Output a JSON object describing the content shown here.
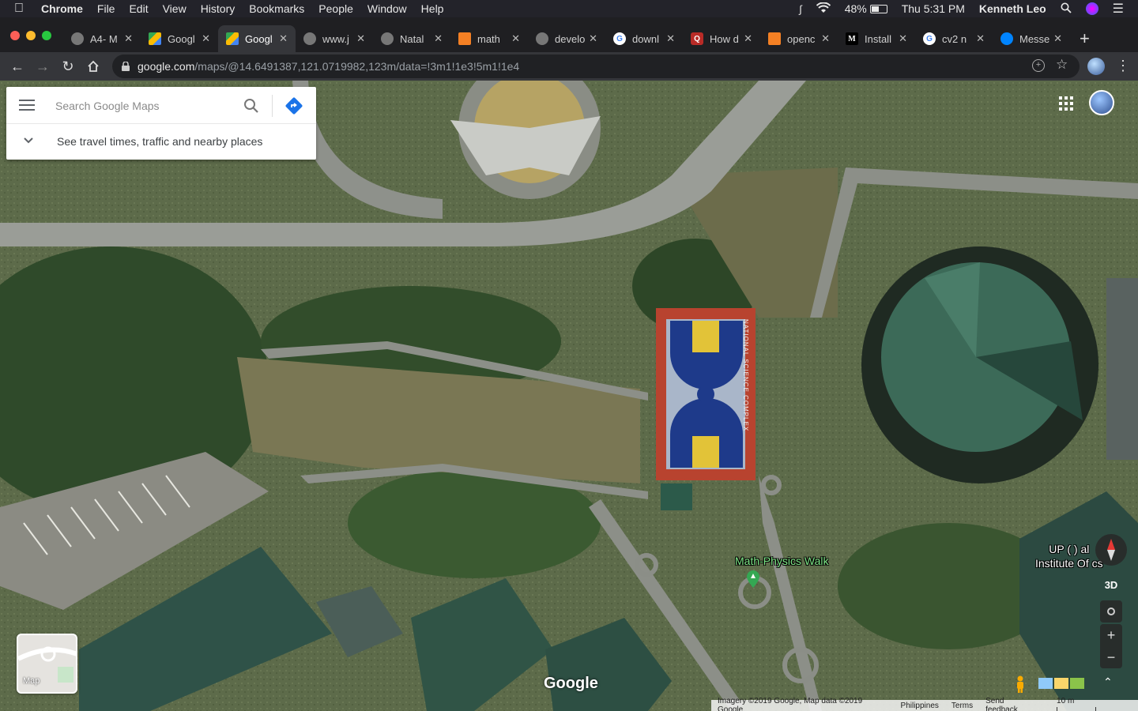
{
  "menubar": {
    "app": "Chrome",
    "items": [
      "File",
      "Edit",
      "View",
      "History",
      "Bookmarks",
      "People",
      "Window",
      "Help"
    ],
    "battery": "48%",
    "clock": "Thu 5:31 PM",
    "user": "Kenneth Leo"
  },
  "tabs": [
    {
      "label": "A4- M",
      "icon": "globe-icon"
    },
    {
      "label": "Googl",
      "icon": "maps-icon"
    },
    {
      "label": "Googl",
      "icon": "maps-icon",
      "active": true
    },
    {
      "label": "www.j",
      "icon": "globe-icon"
    },
    {
      "label": "Natal",
      "icon": "globe-icon"
    },
    {
      "label": "math",
      "icon": "stackoverflow-icon"
    },
    {
      "label": "develo",
      "icon": "globe-icon"
    },
    {
      "label": "downl",
      "icon": "google-icon"
    },
    {
      "label": "How d",
      "icon": "quora-icon"
    },
    {
      "label": "openc",
      "icon": "stackoverflow-icon"
    },
    {
      "label": "Install",
      "icon": "medium-icon"
    },
    {
      "label": "cv2 n",
      "icon": "google-icon"
    },
    {
      "label": "Messe",
      "icon": "messenger-icon"
    }
  ],
  "address": {
    "host": "google.com",
    "path": "/maps/@14.6491387,121.0719982,123m/data=!3m1!1e3!5m1!1e4"
  },
  "search": {
    "placeholder": "Search Google Maps",
    "travel_text": "See travel times, traffic and nearby places"
  },
  "map": {
    "poi_math": "Math-Physics Walk",
    "poi_up_line1": "UP (        ) al",
    "poi_up_line2": "Institute Of        cs",
    "court_text": "NATIONAL SCIENCE COMPLEX",
    "layer_label": "Map",
    "btn_3d": "3D",
    "zoom_in": "+",
    "zoom_out": "−",
    "logo": "Google"
  },
  "footer": {
    "imagery": "Imagery ©2019 Google, Map data ©2019 Google",
    "region": "Philippines",
    "terms": "Terms",
    "feedback": "Send feedback",
    "scale": "10 m"
  },
  "colors": {
    "poi_green": "#7ee787",
    "brand_blue": "#4285f4"
  }
}
